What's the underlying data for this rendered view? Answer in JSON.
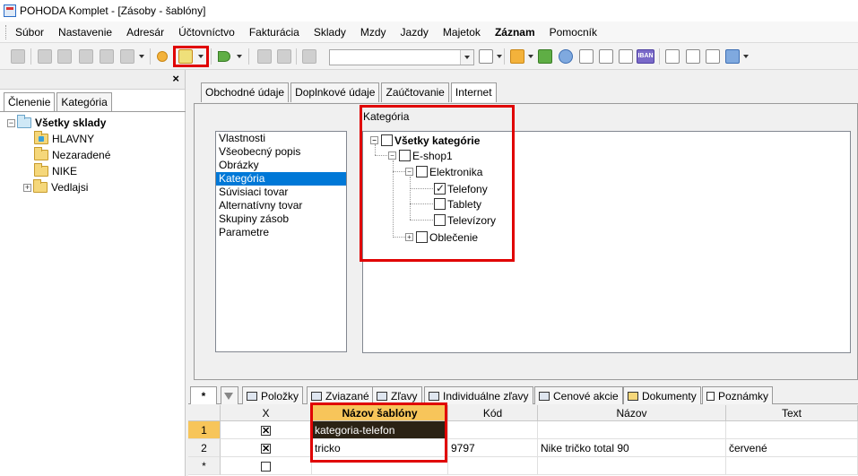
{
  "window": {
    "title": "POHODA Komplet - [Zásoby - šablóny]"
  },
  "menu": {
    "items": [
      "Súbor",
      "Nastavenie",
      "Adresár",
      "Účtovníctvo",
      "Fakturácia",
      "Sklady",
      "Mzdy",
      "Jazdy",
      "Majetok",
      "Záznam",
      "Pomocník"
    ],
    "bold_item": "Záznam"
  },
  "toolbar": {
    "iban_label": "IBAN",
    "combo_value": ""
  },
  "left_panel": {
    "close_label": "×",
    "tabs": [
      "Členenie",
      "Kategória"
    ],
    "active_tab": "Členenie",
    "tree": {
      "root": "Všetky sklady",
      "children": [
        "HLAVNY",
        "Nezaradené",
        "NIKE",
        "Vedlajsi"
      ]
    }
  },
  "main": {
    "tabs": [
      "Obchodné údaje",
      "Doplnkové údaje",
      "Zaúčtovanie",
      "Internet"
    ],
    "active_tab": "Internet",
    "properties": [
      "Vlastnosti",
      "Všeobecný popis",
      "Obrázky",
      "Kategória",
      "Súvisiaci tovar",
      "Alternatívny tovar",
      "Skupiny zásob",
      "Parametre"
    ],
    "selected_property": "Kategória",
    "category_label": "Kategória",
    "categories": {
      "root": "Všetky kategórie",
      "eshop": "E-shop1",
      "electronics": "Elektronika",
      "phones": "Telefony",
      "tablets": "Tablety",
      "tvs": "Televízory",
      "clothes": "Oblečenie",
      "phones_checked": true
    }
  },
  "bottom_tabs": {
    "first": "*",
    "items": [
      "Položky",
      "Zviazané",
      "Zľavy",
      "Individuálne zľavy",
      "Cenové akcie",
      "Dokumenty",
      "Poznámky"
    ]
  },
  "grid": {
    "columns": [
      "X",
      "Názov šablóny",
      "Kód",
      "Názov",
      "Text"
    ],
    "rows": [
      {
        "num": "1",
        "x": true,
        "template": "kategoria-telefon",
        "code": "",
        "name": "",
        "text": ""
      },
      {
        "num": "2",
        "x": true,
        "template": "tricko",
        "code": "9797",
        "name": "Nike tričko total 90",
        "text": "červené"
      }
    ],
    "new_row_marker": "*"
  }
}
